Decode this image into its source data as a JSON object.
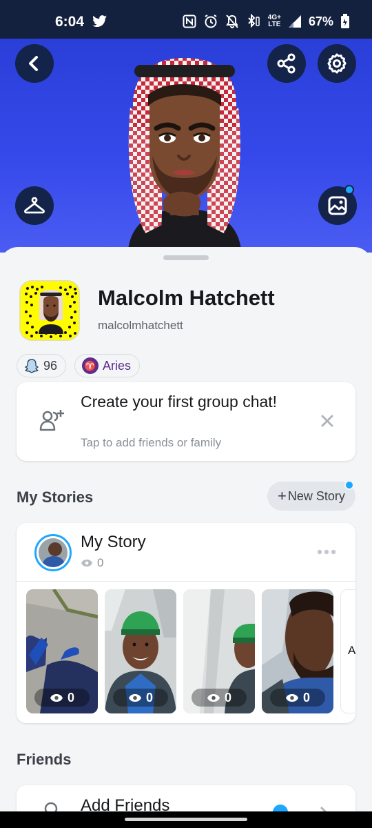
{
  "status_bar": {
    "time": "6:04",
    "network_top": "4G+",
    "network_bottom": "LTE",
    "battery": "67%"
  },
  "header": {
    "back_icon": "chevron-left-icon",
    "share_icon": "share-icon",
    "settings_icon": "gear-icon",
    "outfit_icon": "hanger-icon",
    "background_icon": "image-sparkle-icon"
  },
  "profile": {
    "display_name": "Malcolm Hatchett",
    "username": "malcolmhatchett",
    "snapscore": "96",
    "zodiac": "Aries",
    "zodiac_symbol": "♈"
  },
  "group_chat_card": {
    "title": "Create your first group chat!",
    "subtitle": "Tap to add friends or family"
  },
  "my_stories": {
    "section_title": "My Stories",
    "new_story_label": "New Story",
    "story": {
      "title": "My Story",
      "views": "0"
    },
    "thumbnails": [
      {
        "views": "0"
      },
      {
        "views": "0"
      },
      {
        "views": "0"
      },
      {
        "views": "0"
      }
    ],
    "overflow_letter": "A"
  },
  "friends": {
    "section_title": "Friends",
    "add_friends_label": "Add Friends"
  },
  "colors": {
    "banner_blue": "#3549ea",
    "button_navy": "#14234a",
    "snapcode_yellow": "#fffc00",
    "notification_blue": "#1ea7ff",
    "zodiac_purple": "#5c2d91"
  }
}
